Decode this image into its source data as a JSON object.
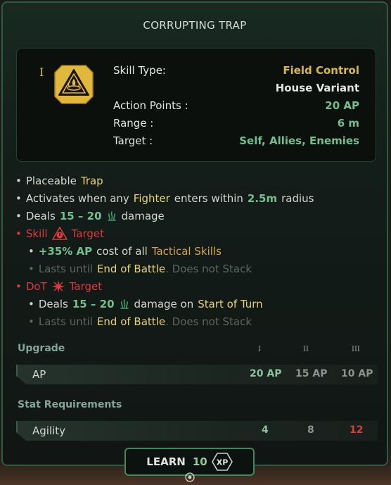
{
  "title": "CORRUPTING TRAP",
  "tier": "I",
  "icons": {
    "skill": "corruption-trap-icon",
    "damage": "corruption-flame-icon",
    "skill_debuff": "skill-debuff-icon",
    "dot": "dot-icon",
    "xp": "xp-hexagon-icon",
    "target": "target-marker-icon"
  },
  "info": {
    "skill_type_label": "Skill Type:",
    "skill_type_value": "Field Control",
    "variant_value": "House Variant",
    "action_points_label": "Action Points :",
    "action_points_value": "20 AP",
    "range_label": "Range :",
    "range_value": "6 m",
    "target_label": "Target :",
    "target_value": "Self, Allies, Enemies"
  },
  "effects": {
    "l1_text": "Placeable",
    "l1_hl": "Trap",
    "l2_text": "Activates when any",
    "l2_hl": "Fighter",
    "l2_text2": "enters within",
    "l2_value": "2.5m",
    "l2_text3": "radius",
    "l3_text": "Deals",
    "l3_value": "15 – 20",
    "l3_text2": "damage",
    "l4_status": "Skill",
    "l4_target": "Target",
    "l5_value": "+35% AP",
    "l5_text": "cost of all",
    "l5_hl": "Tactical Skills",
    "l6_text": "Lasts until",
    "l6_hl": "End of Battle",
    "l6_text2": ". Does not Stack",
    "l7_status": "DoT",
    "l7_target": "Target",
    "l8_text": "Deals",
    "l8_value": "15 – 20",
    "l8_text2": "damage on",
    "l8_hl": "Start of Turn",
    "l9_text": "Lasts until",
    "l9_hl": "End of Battle",
    "l9_text2": ". Does not Stack"
  },
  "upgrade": {
    "heading": "Upgrade",
    "columns": [
      "I",
      "II",
      "III"
    ],
    "ap_label": "AP",
    "ap_values": [
      "20 AP",
      "15 AP",
      "10 AP"
    ]
  },
  "requirements": {
    "heading": "Stat Requirements",
    "stat_label": "Agility",
    "values": [
      "4",
      "8",
      "12"
    ]
  },
  "learn": {
    "label": "LEARN",
    "cost": "10",
    "currency": "XP"
  },
  "colors": {
    "gold": "#d9b941",
    "green": "#72c08f",
    "red": "#de3a3a",
    "highlight_yellow": "#e6d467",
    "highlight_orange": "#d9a43b",
    "dim": "#5c6660"
  }
}
